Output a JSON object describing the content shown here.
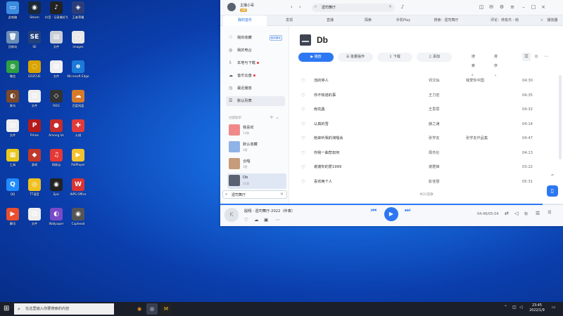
{
  "desktop_icons": [
    {
      "label": "此电脑",
      "color": "#3c8de0",
      "glyph": "▭",
      "icon": "computer-icon"
    },
    {
      "label": "Steam",
      "color": "#1b2838",
      "glyph": "◉",
      "icon": "steam-icon"
    },
    {
      "label": "抖音 · 记录美好生活",
      "color": "#222",
      "glyph": "♪",
      "icon": "douyin-icon"
    },
    {
      "label": "王者荣耀",
      "color": "#2c3e7a",
      "glyph": "◈",
      "icon": "game-icon"
    },
    {
      "label": "回收站",
      "color": "#6b8fb8",
      "glyph": "🗑",
      "icon": "recycle-bin-icon"
    },
    {
      "label": "SE",
      "color": "#23417a",
      "glyph": "SE",
      "icon": "se-icon"
    },
    {
      "label": "文件",
      "color": "#c9ced6",
      "glyph": "▤",
      "icon": "file-icon"
    },
    {
      "label": "images",
      "color": "#e8e8e8",
      "glyph": "▢",
      "icon": "image-file-icon"
    },
    {
      "label": "微信",
      "color": "#2ea043",
      "glyph": "◍",
      "icon": "wechat-icon"
    },
    {
      "label": "EOZCUE",
      "color": "#d9a400",
      "glyph": "◌",
      "icon": "app-icon"
    },
    {
      "label": "文件",
      "color": "#eeeeee",
      "glyph": "▤",
      "icon": "document-icon"
    },
    {
      "label": "Microsoft Edge",
      "color": "#1c7ad8",
      "glyph": "e",
      "icon": "edge-icon"
    },
    {
      "label": "青鸟",
      "color": "#7c4a2a",
      "glyph": "◐",
      "icon": "app-icon"
    },
    {
      "label": "文件",
      "color": "#eeeeee",
      "glyph": "▤",
      "icon": "document-icon"
    },
    {
      "label": "ROG",
      "color": "#333",
      "glyph": "◇",
      "icon": "rog-icon"
    },
    {
      "label": "百度网盘",
      "color": "#d77b2b",
      "glyph": "☁",
      "icon": "baidu-netdisk-icon"
    },
    {
      "label": "文件",
      "color": "#eeeeee",
      "glyph": "▤",
      "icon": "document-icon"
    },
    {
      "label": "Prime",
      "color": "#b51a1a",
      "glyph": "P",
      "icon": "app-icon"
    },
    {
      "label": "Among Us",
      "color": "#c72c2c",
      "glyph": "●",
      "icon": "among-us-icon"
    },
    {
      "label": "火绒",
      "color": "#e33b3b",
      "glyph": "✚",
      "icon": "app-icon"
    },
    {
      "label": "工具",
      "color": "#e9c81e",
      "glyph": "▦",
      "icon": "tool-icon"
    },
    {
      "label": "游戏",
      "color": "#c0392b",
      "glyph": "◆",
      "icon": "game-icon"
    },
    {
      "label": "网易云",
      "color": "#e53935",
      "glyph": "♫",
      "icon": "music-icon"
    },
    {
      "label": "PotPlayer",
      "color": "#f2c230",
      "glyph": "▶",
      "icon": "potplayer-icon"
    },
    {
      "label": "QQ",
      "color": "#1f8cff",
      "glyph": "Q",
      "icon": "qq-icon"
    },
    {
      "label": "TT语音",
      "color": "#f0c020",
      "glyph": "◎",
      "icon": "app-icon"
    },
    {
      "label": "Epic",
      "color": "#222",
      "glyph": "◉",
      "icon": "app-icon"
    },
    {
      "label": "WPS Office",
      "color": "#d93434",
      "glyph": "W",
      "icon": "wps-icon"
    },
    {
      "label": "腾讯",
      "color": "#e94f2e",
      "glyph": "▶",
      "icon": "video-icon"
    },
    {
      "label": "文件",
      "color": "#eeeeee",
      "glyph": "▤",
      "icon": "document-icon"
    },
    {
      "label": "Wallpaper",
      "color": "#7b4ac7",
      "glyph": "◐",
      "icon": "app-icon"
    },
    {
      "label": "Cuphead",
      "color": "#555",
      "glyph": "◉",
      "icon": "app-icon"
    }
  ],
  "app": {
    "user_name": "主播小哥",
    "vip": "VIP",
    "search_value": "遗司舞厅",
    "tabs": [
      {
        "label": "我的音乐",
        "active": true
      },
      {
        "label": "发现",
        "active": false
      },
      {
        "label": "直播",
        "active": false
      },
      {
        "label": "探索",
        "active": false
      },
      {
        "label": "手机Play",
        "active": false
      },
      {
        "label": "搜索：遗司舞厅",
        "active": false
      },
      {
        "label": "评论：林俊杰 - 她",
        "active": false
      }
    ],
    "tab_close": "×",
    "mini_mode": "播放器",
    "sidebar": {
      "items": [
        {
          "label": "我的收藏",
          "icon": "heart-icon",
          "glyph": "♡",
          "badge": "我的喜欢",
          "dot": false
        },
        {
          "label": "我的电台",
          "icon": "radio-icon",
          "glyph": "◎",
          "badge": "",
          "dot": false
        },
        {
          "label": "本地与下载",
          "icon": "download-icon",
          "glyph": "⇩",
          "badge": "",
          "dot": true
        },
        {
          "label": "音乐云盘",
          "icon": "cloud-icon",
          "glyph": "☁",
          "badge": "",
          "dot": true
        },
        {
          "label": "最近播放",
          "icon": "clock-icon",
          "glyph": "◷",
          "badge": "",
          "dot": false
        },
        {
          "label": "默认列表",
          "icon": "list-icon",
          "glyph": "☰",
          "badge": "",
          "dot": false,
          "selected": true
        }
      ],
      "section_title": "创建歌单",
      "section_ops": "+  ⌄",
      "playlists": [
        {
          "name": "我喜欢",
          "count": "13首",
          "color": "#f08a8a"
        },
        {
          "name": "默认收藏",
          "count": "3首",
          "color": "#8fb3e6"
        },
        {
          "name": "合唱",
          "count": "3首",
          "color": "#c79c7a"
        },
        {
          "name": "Db",
          "count": "31首",
          "color": "#5a6170",
          "selected": true
        }
      ],
      "search_value": "遗司舞厅"
    },
    "main": {
      "title": "Db",
      "buttons": [
        "播放",
        "批量操作",
        "下载",
        "添加"
      ],
      "search_label": "搜索",
      "sort_label": "排序",
      "songs": [
        {
          "title": "流的停人",
          "artist": "邓文仙",
          "album": "我爱你中国",
          "duration": "04:30"
        },
        {
          "title": "你不知道的事",
          "artist": "王力宏",
          "album": "",
          "duration": "04:35"
        },
        {
          "title": "雨花蠡",
          "artist": "王思思",
          "album": "",
          "duration": "04:32"
        },
        {
          "title": "认真的雪",
          "artist": "薛之谦",
          "album": "",
          "duration": "04:14"
        },
        {
          "title": "她来听我的演唱会",
          "artist": "张学友",
          "album": "张学友作品集",
          "duration": "04:47"
        },
        {
          "title": "你我一曲悲如何",
          "artist": "周杰伦",
          "album": "",
          "duration": "04:13"
        },
        {
          "title": "谢谢你的爱1999",
          "artist": "谢霆锋",
          "album": "",
          "duration": "03:22"
        },
        {
          "title": "喜欢两个人",
          "artist": "彭佳慧",
          "album": "",
          "duration": "05:31"
        }
      ],
      "all_songs_label": "共31首歌"
    },
    "player": {
      "track": "殷翔 - 遗司舞厅-2022（伴奏）",
      "time": "04:46/05:04",
      "progress": 0.94,
      "quality": "标",
      "lyric": "词"
    }
  },
  "taskbar": {
    "search_placeholder": "在这里输入你要搜索的内容",
    "time": "23:45",
    "date": "2022/1/9"
  },
  "colors": {
    "accent": "#2d77f2",
    "wallpaper": "#1565d8"
  }
}
